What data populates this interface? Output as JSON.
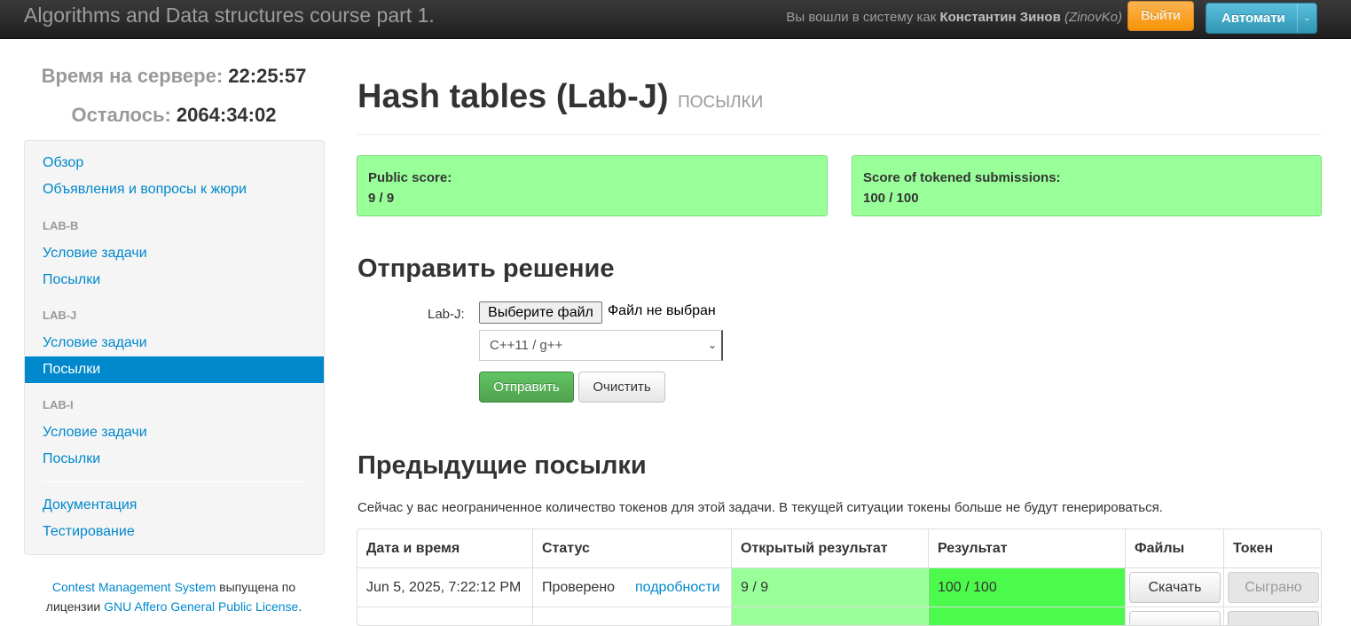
{
  "navbar": {
    "brand": "Algorithms and Data structures course part 1.",
    "login_prefix": "Вы вошли в систему как ",
    "user_name": "Константин Зинов",
    "user_login": "(ZinovKo)",
    "logout_label": "Выйти",
    "language_label": "Автоматически"
  },
  "clock": {
    "server_label": "Время на сервере:",
    "server_time": "22:25:57",
    "remaining_label": "Осталось:",
    "remaining_time": "2064:34:02"
  },
  "sidebar": {
    "overview": "Обзор",
    "announcements": "Объявления и вопросы к жюри",
    "tasks": [
      {
        "header": "LAB-B",
        "statement": "Условие задачи",
        "submissions": "Посылки"
      },
      {
        "header": "LAB-J",
        "statement": "Условие задачи",
        "submissions": "Посылки"
      },
      {
        "header": "LAB-I",
        "statement": "Условие задачи",
        "submissions": "Посылки"
      }
    ],
    "documentation": "Документация",
    "testing": "Тестирование"
  },
  "license": {
    "cms_link": "Contest Management System",
    "text_1": " выпущена по",
    "text_2": "лицензии ",
    "license_link": "GNU Affero General Public License",
    "text_3": "."
  },
  "main": {
    "title": "Hash tables (Lab-J)",
    "subtitle": "посылки",
    "public_score_label": "Public score:",
    "public_score_value": "9 / 9",
    "token_score_label": "Score of tokened submissions:",
    "token_score_value": "100 / 100",
    "submit_heading": "Отправить решение",
    "file_label": "Lab-J:",
    "file_button": "Выберите файл",
    "file_status": "Файл не выбран",
    "language_selected": "C++11 / g++",
    "send_button": "Отправить",
    "clear_button": "Очистить",
    "previous_heading": "Предыдущие посылки",
    "token_note": "Сейчас у вас неограниченное количество токенов для этой задачи. В текущей ситуации токены больше не будут генерироваться."
  },
  "table": {
    "headers": [
      "Дата и время",
      "Статус",
      "Открытый результат",
      "Результат",
      "Файлы",
      "Токен"
    ],
    "rows": [
      {
        "datetime": "Jun 5, 2025, 7:22:12 PM",
        "status": "Проверено",
        "details_link": "подробности",
        "public_result": "9 / 9",
        "result": "100 / 100",
        "download": "Скачать",
        "token": "Сыграно"
      }
    ]
  },
  "colors": {
    "navbar_bg": "#222222",
    "link": "#0088cc",
    "score_box": "#99ff99",
    "full_score": "#4cfa4c",
    "logout": "#f89406",
    "language_button": "#2f96b4"
  }
}
